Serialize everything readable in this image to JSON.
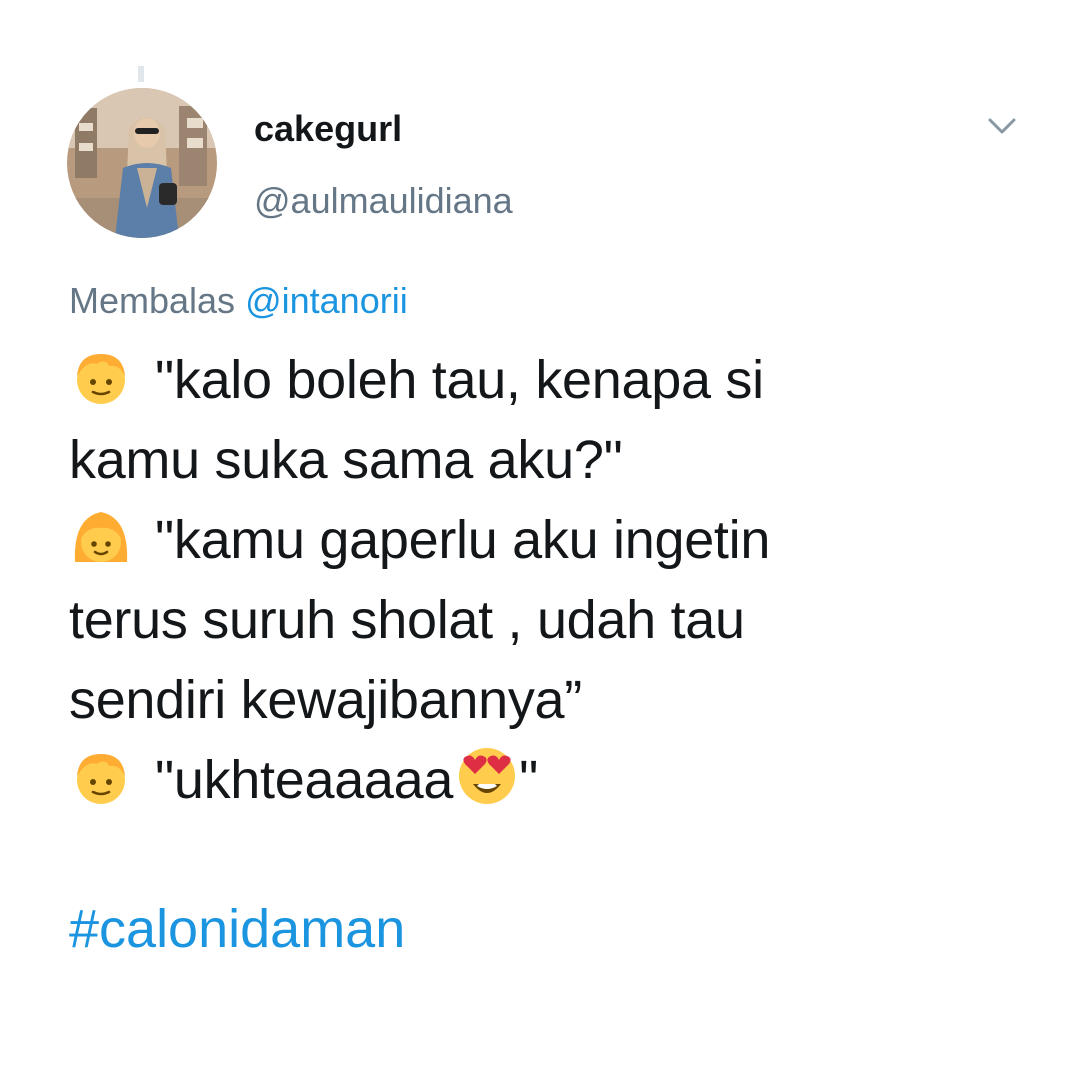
{
  "tweet": {
    "display_name": "cakegurl",
    "handle": "@aulmaulidiana",
    "reply_prefix": "Membalas",
    "reply_mention": "@intanorii",
    "lines": [
      {
        "emoji": "boy-emoji",
        "text": "\"kalo boleh tau, kenapa si"
      },
      {
        "emoji": "",
        "text": "kamu suka sama aku?\""
      },
      {
        "emoji": "girl-emoji",
        "text": "\"kamu gaperlu aku ingetin"
      },
      {
        "emoji": "",
        "text": "terus suruh sholat , udah tau"
      },
      {
        "emoji": "",
        "text": "sendiri kewajibannya”"
      },
      {
        "emoji": "boy-emoji",
        "text": "\"ukhteaaaaa",
        "inline_emoji": "heart-eyes-emoji",
        "trailing": "\""
      }
    ],
    "hashtag": "#calonidaman"
  },
  "icons": {
    "menu": "chevron-down-icon",
    "avatar": "avatar-photo"
  },
  "colors": {
    "text": "#14171a",
    "secondary": "#657786",
    "link": "#1b95e0",
    "emoji_yellow": "#ffcc4d"
  }
}
